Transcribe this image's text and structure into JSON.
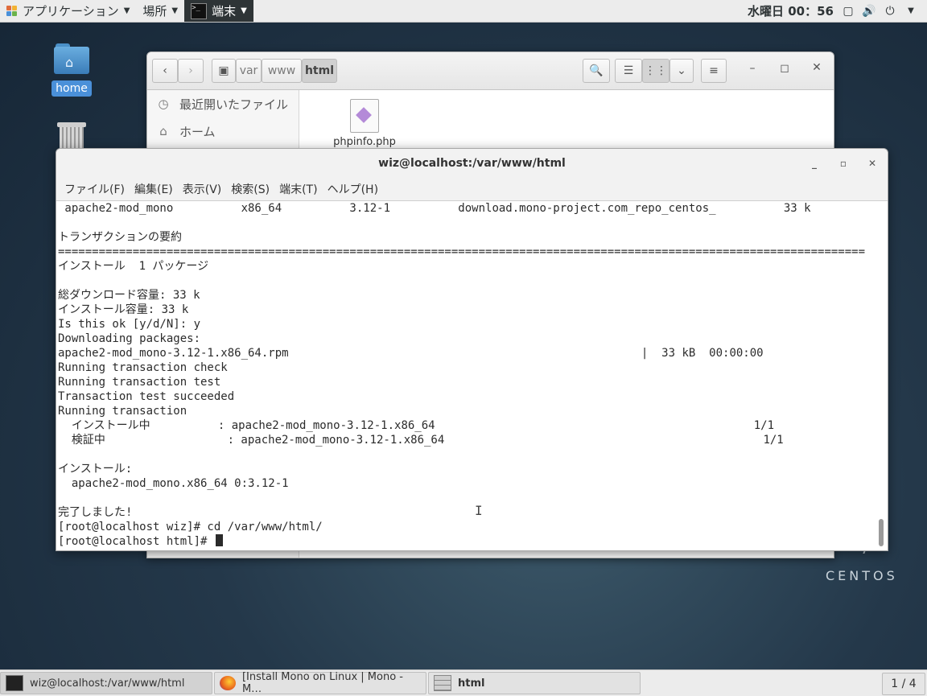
{
  "topbar": {
    "applications": "アプリケーション",
    "places": "場所",
    "terminal_app": "端末",
    "clock": "水曜日 00：56"
  },
  "desktop": {
    "home_label": "home",
    "brand": "CENTOS"
  },
  "file_manager": {
    "breadcrumbs": [
      "var",
      "www",
      "html"
    ],
    "sidebar": [
      {
        "label": "最近開いたファイル",
        "icon": "clock-icon"
      },
      {
        "label": "ホーム",
        "icon": "home-icon"
      }
    ],
    "files": [
      {
        "name": "phpinfo.php",
        "icon": "php-file-icon"
      }
    ]
  },
  "terminal": {
    "title": "wiz@localhost:/var/www/html",
    "menu": [
      "ファイル(F)",
      "編集(E)",
      "表示(V)",
      "検索(S)",
      "端末(T)",
      "ヘルプ(H)"
    ],
    "lines": [
      " apache2-mod_mono          x86_64          3.12-1          download.mono-project.com_repo_centos_          33 k",
      "",
      "トランザクションの要約",
      "=======================================================================================================================",
      "インストール  1 パッケージ",
      "",
      "総ダウンロード容量: 33 k",
      "インストール容量: 33 k",
      "Is this ok [y/d/N]: y",
      "Downloading packages:",
      "apache2-mod_mono-3.12-1.x86_64.rpm                                                    |  33 kB  00:00:00",
      "Running transaction check",
      "Running transaction test",
      "Transaction test succeeded",
      "Running transaction",
      "  インストール中          : apache2-mod_mono-3.12-1.x86_64                                               1/1",
      "  検証中                  : apache2-mod_mono-3.12-1.x86_64                                               1/1",
      "",
      "インストール:",
      "  apache2-mod_mono.x86_64 0:3.12-1",
      "",
      "完了しました!",
      "[root@localhost wiz]# cd /var/www/html/"
    ],
    "prompt": "[root@localhost html]# "
  },
  "taskbar": {
    "tasks": [
      {
        "label": "wiz@localhost:/var/www/html",
        "active": true
      },
      {
        "label": "[Install Mono on Linux | Mono - M…",
        "active": false
      },
      {
        "label": "html",
        "active": false
      }
    ],
    "pager": "1 / 4"
  }
}
